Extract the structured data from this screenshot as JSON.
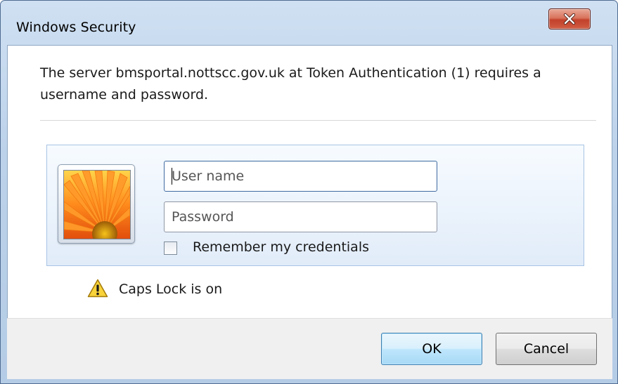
{
  "window": {
    "title": "Windows Security",
    "close_icon": "close-icon"
  },
  "message": {
    "text": "The server bmsportal.nottscc.gov.uk at Token Authentication (1) requires a username and password."
  },
  "credentials": {
    "avatar_icon": "user-tile-flower-icon",
    "username": {
      "value": "",
      "placeholder": "User name"
    },
    "password": {
      "value": "",
      "placeholder": "Password"
    },
    "remember": {
      "label": "Remember my credentials",
      "checked": false
    }
  },
  "warning": {
    "icon": "warning-triangle-icon",
    "text": "Caps Lock is on"
  },
  "buttons": {
    "ok_label": "OK",
    "cancel_label": "Cancel"
  },
  "colors": {
    "title_bar": "#bcd2ea",
    "close_button": "#c3412b",
    "panel_border": "#a8c3e4",
    "ok_accent": "#3c7fb1"
  }
}
